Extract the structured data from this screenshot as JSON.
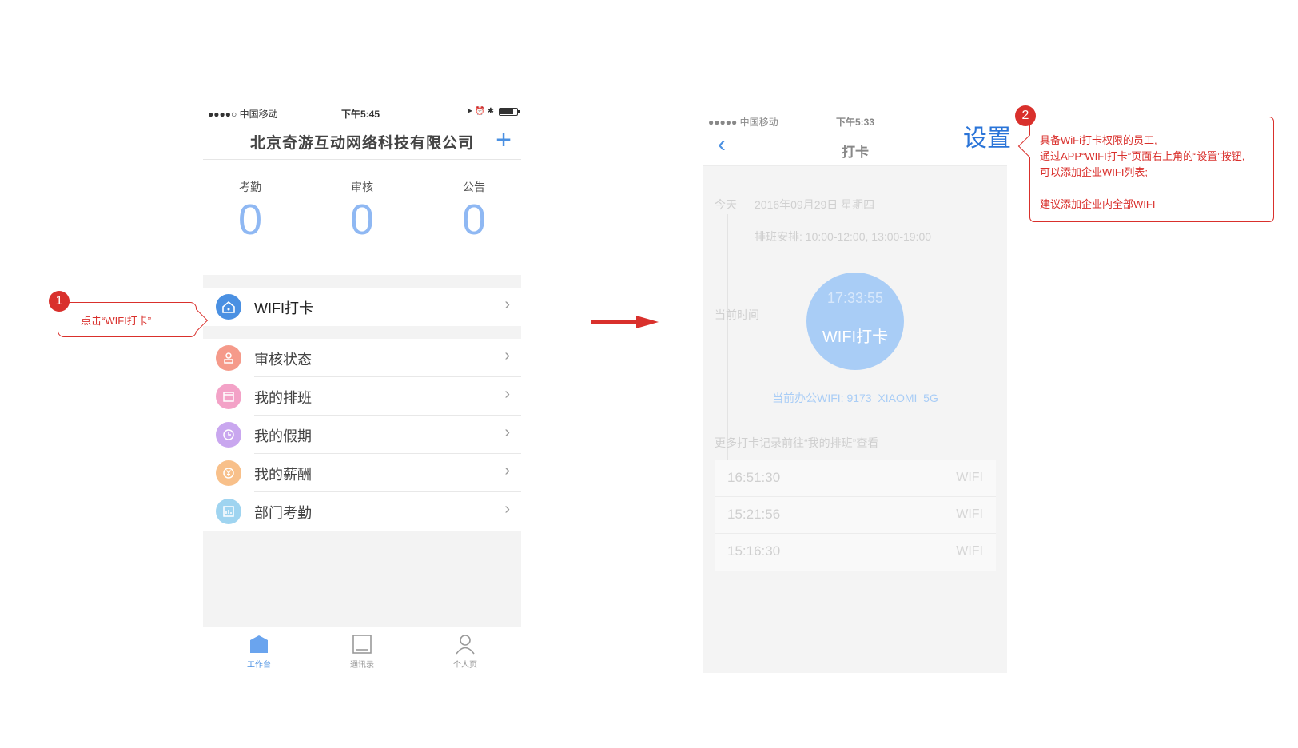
{
  "phone1": {
    "status": {
      "carrier": "●●●●○ 中国移动",
      "time": "下午5:45",
      "right_icons": "➤ ⏰ ✱"
    },
    "header": {
      "title": "北京奇游互动网络科技有限公司",
      "plus": "+"
    },
    "stats": [
      {
        "label": "考勤",
        "value": "0"
      },
      {
        "label": "审核",
        "value": "0"
      },
      {
        "label": "公告",
        "value": "0"
      }
    ],
    "menu": [
      {
        "label": "WIFI打卡",
        "icon": "wifi-house-icon",
        "color": "#4a90e2"
      },
      {
        "label": "审核状态",
        "icon": "stamp-icon",
        "color": "#f59a8a"
      },
      {
        "label": "我的排班",
        "icon": "calendar-icon",
        "color": "#f3a2c7"
      },
      {
        "label": "我的假期",
        "icon": "clock-icon",
        "color": "#c9a7ef"
      },
      {
        "label": "我的薪酬",
        "icon": "yen-icon",
        "color": "#f8c08a"
      },
      {
        "label": "部门考勤",
        "icon": "chart-icon",
        "color": "#9fd4f0"
      }
    ],
    "chevron": "›",
    "tabs": [
      {
        "label": "工作台",
        "icon": "home-icon"
      },
      {
        "label": "通讯录",
        "icon": "contacts-icon"
      },
      {
        "label": "个人页",
        "icon": "person-icon"
      }
    ]
  },
  "callout1": {
    "number": "1",
    "text": "点击“WIFI打卡”"
  },
  "phone2": {
    "status": {
      "carrier": "●●●●● 中国移动",
      "time": "下午5:33"
    },
    "back": "‹",
    "title": "打卡",
    "settings": "设置",
    "today_label": "今天",
    "date": "2016年09月29日 星期四",
    "schedule": "排班安排: 10:00-12:00, 13:00-19:00",
    "current_time_label": "当前时间",
    "clock_time": "17:33:55",
    "clock_button": "WIFI打卡",
    "current_wifi": "当前办公WIFI: 9173_XIAOMI_5G",
    "more_text": "更多打卡记录前往“我的排班”查看",
    "records": [
      {
        "time": "16:51:30",
        "type": "WIFI"
      },
      {
        "time": "15:21:56",
        "type": "WIFI"
      },
      {
        "time": "15:16:30",
        "type": "WIFI"
      }
    ]
  },
  "callout2": {
    "number": "2",
    "lines": [
      "具备WiFi打卡权限的员工,",
      "通过APP“WIFI打卡”页面右上角的“设置”按钮,",
      "可以添加企业WIFI列表;",
      "建议添加企业内全部WIFI"
    ]
  },
  "colors": {
    "accent": "#4a90e2",
    "annotation": "#d9302c",
    "stat_number": "#8fb8f3",
    "clock_circle": "#a9cdf6"
  }
}
